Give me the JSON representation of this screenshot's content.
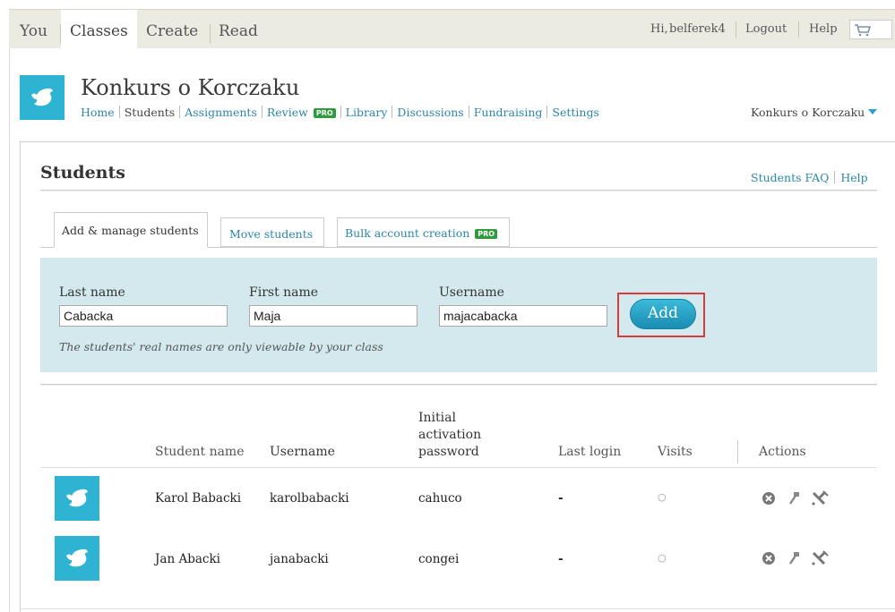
{
  "topnav": {
    "items": [
      "You",
      "Classes",
      "Create",
      "Read"
    ],
    "active_index": 1,
    "greeting_prefix": "Hi,",
    "username": "belferek4",
    "logout": "Logout",
    "help": "Help",
    "cart_icon": "cart-icon"
  },
  "class_header": {
    "title": "Konkurs o Korczaku",
    "logo_icon": "bird-icon",
    "nav": [
      "Home",
      "Students",
      "Assignments",
      "Review",
      "Library",
      "Discussions",
      "Fundraising",
      "Settings"
    ],
    "current_index": 1,
    "pro_badge": "PRO",
    "dropdown_label": "Konkurs o Korczaku"
  },
  "students_panel": {
    "title": "Students",
    "faq_link": "Students FAQ",
    "help_link": "Help",
    "tabs": [
      "Add & manage students",
      "Move students",
      "Bulk account creation"
    ],
    "active_tab": 0,
    "tab_pro_badge": "PRO"
  },
  "add_form": {
    "last_name_label": "Last name",
    "last_name_value": "Cabacka",
    "first_name_label": "First name",
    "first_name_value": "Maja",
    "username_label": "Username",
    "username_value": "majacabacka",
    "add_button": "Add",
    "privacy_note": "The students' real names are only viewable by your class"
  },
  "table": {
    "headers": {
      "student_name": "Student name",
      "username": "Username",
      "password_line1": "Initial",
      "password_line2": "activation",
      "password_line3": "password",
      "last_login": "Last login",
      "visits": "Visits",
      "actions": "Actions"
    },
    "rows": [
      {
        "name": "Karol Babacki",
        "username": "karolbabacki",
        "password": "cahuco",
        "last_login": "-",
        "visits": "○"
      },
      {
        "name": "Jan Abacki",
        "username": "janabacki",
        "password": "congei",
        "last_login": "-",
        "visits": "○"
      }
    ],
    "action_icons": [
      "delete-icon",
      "key-icon",
      "tools-icon"
    ]
  },
  "colors": {
    "accent": "#2fb3d3",
    "link": "#2b86a8",
    "form_bg": "#d3e9ee",
    "pro_badge": "#2e9b3d",
    "highlight": "#d93a3a"
  }
}
